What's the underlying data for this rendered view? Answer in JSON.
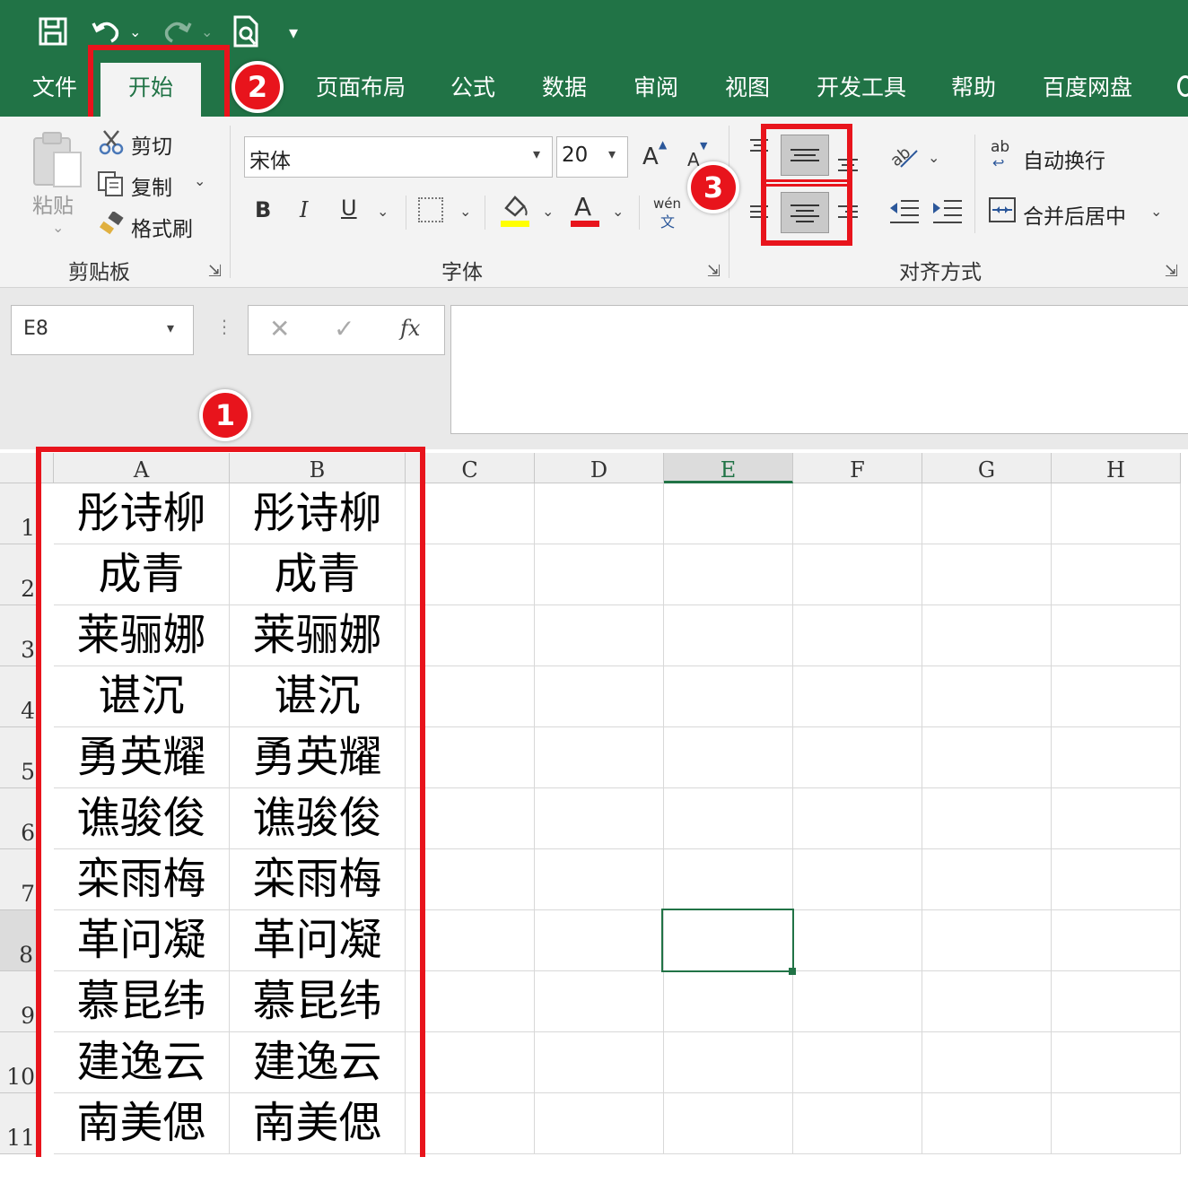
{
  "tabs": {
    "file": "文件",
    "home": "开始",
    "layout": "页面布局",
    "formulas": "公式",
    "data": "数据",
    "review": "审阅",
    "view": "视图",
    "developer": "开发工具",
    "help": "帮助",
    "baidu": "百度网盘"
  },
  "clipboard": {
    "paste": "粘贴",
    "cut": "剪切",
    "copy": "复制",
    "format_painter": "格式刷",
    "group_label": "剪贴板"
  },
  "font": {
    "name": "宋体",
    "size": "20",
    "grow": "A",
    "shrink": "A",
    "bold": "B",
    "italic": "I",
    "underline": "U",
    "fill_label": "A",
    "phonetic_top": "wén",
    "phonetic_bottom": "文",
    "group_label": "字体",
    "colors": {
      "fill": "#ffff00",
      "font": "#e8141c"
    }
  },
  "alignment": {
    "wrap_text": "自动换行",
    "wrap_icon_text": "ab",
    "merge_center": "合并后居中",
    "group_label": "对齐方式"
  },
  "formula_bar": {
    "name_box": "E8",
    "fx": "fx",
    "value": ""
  },
  "grid": {
    "columns": [
      "A",
      "B",
      "C",
      "D",
      "E",
      "F",
      "G",
      "H"
    ],
    "rows": [
      "1",
      "2",
      "3",
      "4",
      "5",
      "6",
      "7",
      "8",
      "9",
      "10",
      "11"
    ],
    "col_a": [
      "彤诗柳",
      "成青",
      "莱骊娜",
      "谌沉",
      "勇英耀",
      "谯骏俊",
      "栾雨梅",
      "革问凝",
      "慕昆纬",
      "建逸云",
      "南美偲"
    ],
    "col_b": [
      "彤诗柳",
      "成青",
      "莱骊娜",
      "谌沉",
      "勇英耀",
      "谯骏俊",
      "栾雨梅",
      "革问凝",
      "慕昆纬",
      "建逸云",
      "南美偲"
    ],
    "selected_cell": "E8"
  },
  "badges": {
    "one": "1",
    "two": "2",
    "three": "3"
  },
  "accent": "#217346",
  "highlight": "#e8141c"
}
